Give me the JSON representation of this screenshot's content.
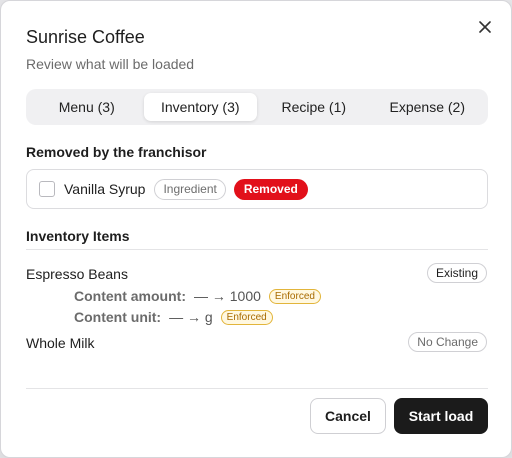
{
  "dialog": {
    "title": "Sunrise Coffee",
    "subtitle": "Review what will be loaded",
    "close_icon": "close-icon"
  },
  "tabs": [
    {
      "label": "Menu (3)",
      "active": false
    },
    {
      "label": "Inventory (3)",
      "active": true
    },
    {
      "label": "Recipe (1)",
      "active": false
    },
    {
      "label": "Expense (2)",
      "active": false
    }
  ],
  "removed_section": {
    "title": "Removed by the franchisor",
    "item": {
      "name": "Vanilla Syrup",
      "type_chip": "Ingredient",
      "status_chip": "Removed",
      "checked": false
    }
  },
  "inventory_section": {
    "title": "Inventory Items",
    "items": [
      {
        "name": "Espresso Beans",
        "badge": "Existing",
        "changes": [
          {
            "key": "Content amount:",
            "value": "— → 1000",
            "tag": "Enforced"
          },
          {
            "key": "Content unit:",
            "value": "— → g",
            "tag": "Enforced"
          }
        ]
      },
      {
        "name": "Whole Milk",
        "badge": "No Change"
      }
    ]
  },
  "footer": {
    "cancel_label": "Cancel",
    "start_label": "Start load"
  },
  "colors": {
    "removed_red": "#e2101a",
    "primary_button": "#1b1b1b",
    "enforced_border": "#e2b53b",
    "enforced_text": "#a86a00"
  }
}
